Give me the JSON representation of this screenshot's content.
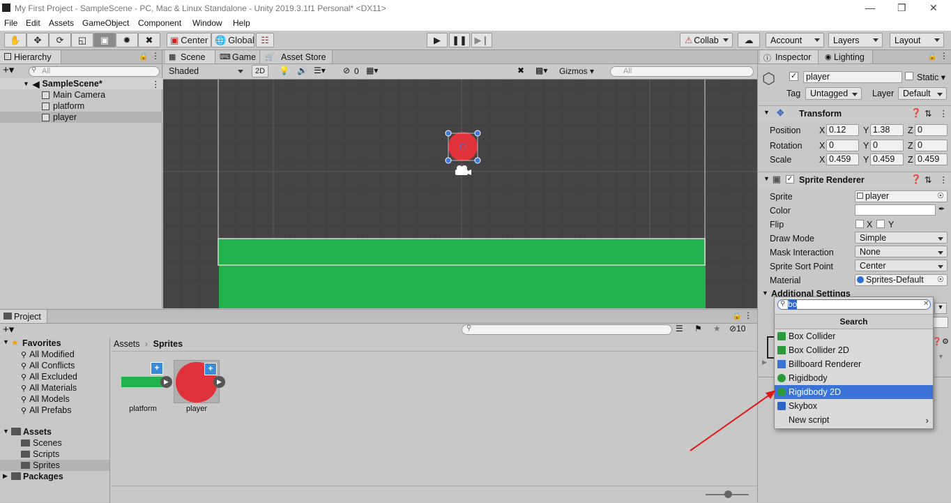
{
  "window": {
    "title": "My First Project - SampleScene - PC, Mac & Linux Standalone - Unity 2019.3.1f1 Personal* <DX11>"
  },
  "menu": [
    "File",
    "Edit",
    "Assets",
    "GameObject",
    "Component",
    "Window",
    "Help"
  ],
  "toolbar": {
    "center_label": "Center",
    "global_label": "Global",
    "collab_label": "Collab",
    "account_label": "Account",
    "layers_label": "Layers",
    "layout_label": "Layout"
  },
  "hierarchy": {
    "tab": "Hierarchy",
    "search_placeholder": "All",
    "scene": "SampleScene*",
    "items": [
      "Main Camera",
      "platform",
      "player"
    ]
  },
  "scene_view": {
    "tabs": [
      "Scene",
      "Game",
      "Asset Store"
    ],
    "shading": "Shaded",
    "mode_2d": "2D",
    "hidden_count": "0",
    "gizmos_label": "Gizmos",
    "search_placeholder": "All",
    "colors": {
      "background": "#444444",
      "platform": "#22b14c",
      "player": "#e0323a"
    }
  },
  "inspector": {
    "tabs": [
      "Inspector",
      "Lighting"
    ],
    "object_name": "player",
    "static_label": "Static",
    "tag_label": "Tag",
    "tag_value": "Untagged",
    "layer_label": "Layer",
    "layer_value": "Default",
    "transform": {
      "title": "Transform",
      "position_label": "Position",
      "rotation_label": "Rotation",
      "scale_label": "Scale",
      "position": {
        "x": "0.12",
        "y": "1.38",
        "z": "0"
      },
      "rotation": {
        "x": "0",
        "y": "0",
        "z": "0"
      },
      "scale": {
        "x": "0.459",
        "y": "0.459",
        "z": "0.459"
      }
    },
    "sprite_renderer": {
      "title": "Sprite Renderer",
      "sprite_label": "Sprite",
      "sprite_value": "player",
      "color_label": "Color",
      "flip_label": "Flip",
      "flip_x": "X",
      "flip_y": "Y",
      "draw_mode_label": "Draw Mode",
      "draw_mode_value": "Simple",
      "mask_label": "Mask Interaction",
      "mask_value": "None",
      "sort_point_label": "Sprite Sort Point",
      "sort_point_value": "Center",
      "material_label": "Material",
      "material_value": "Sprites-Default",
      "additional_settings": "Additional Settings"
    },
    "axis_labels": {
      "x": "X",
      "y": "Y",
      "z": "Z"
    }
  },
  "add_component_popup": {
    "search_value": "bo",
    "header": "Search",
    "items": [
      "Box Collider",
      "Box Collider 2D",
      "Billboard Renderer",
      "Rigidbody",
      "Rigidbody 2D",
      "Skybox",
      "New script"
    ],
    "selected": "Rigidbody 2D"
  },
  "project": {
    "tab": "Project",
    "filter_count": "10",
    "favorites_label": "Favorites",
    "favorites": [
      "All Modified",
      "All Conflicts",
      "All Excluded",
      "All Materials",
      "All Models",
      "All Prefabs"
    ],
    "assets_label": "Assets",
    "asset_folders": [
      "Scenes",
      "Scripts",
      "Sprites"
    ],
    "packages_label": "Packages",
    "breadcrumb": [
      "Assets",
      "Sprites"
    ],
    "files": [
      "platform",
      "player"
    ]
  }
}
